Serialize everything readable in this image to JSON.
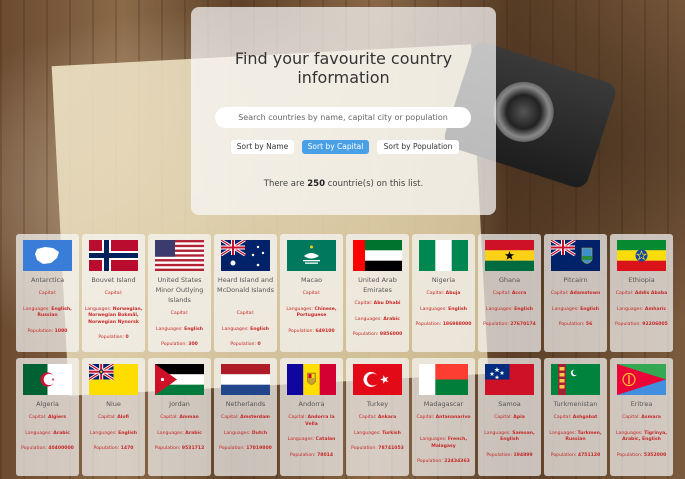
{
  "header": {
    "title": "Find your favourite country information",
    "search_placeholder": "Search countries by name, capital city or population",
    "sort_name": "Sort by Name",
    "sort_capital": "Sort by Capital",
    "sort_population": "Sort by Population",
    "count_prefix": "There are",
    "count_value": "250",
    "count_suffix": "countrie(s) on this list."
  },
  "labels": {
    "capital": "Capital:",
    "languages": "Languages:",
    "population": "Population:"
  },
  "countries": [
    {
      "name": "Antarctica",
      "capital": "",
      "languages": "English, Russian",
      "population": "1000",
      "flag": "antarctica-flag"
    },
    {
      "name": "Bouvet Island",
      "capital": "",
      "languages": "Norwegian, Norwegian Bokmål, Norwegian Nynorsk",
      "population": "0",
      "flag": "norway-flag"
    },
    {
      "name": "United States Minor Outlying Islands",
      "capital": "",
      "languages": "English",
      "population": "300",
      "flag": "usa-flag"
    },
    {
      "name": "Heard Island and McDonald Islands",
      "capital": "",
      "languages": "English",
      "population": "0",
      "flag": "australia-flag"
    },
    {
      "name": "Macao",
      "capital": "",
      "languages": "Chinese, Portuguese",
      "population": "649100",
      "flag": "macao-flag"
    },
    {
      "name": "United Arab Emirates",
      "capital": "Abu Dhabi",
      "languages": "Arabic",
      "population": "9856000",
      "flag": "uae-flag"
    },
    {
      "name": "Nigeria",
      "capital": "Abuja",
      "languages": "English",
      "population": "186988000",
      "flag": "nigeria-flag"
    },
    {
      "name": "Ghana",
      "capital": "Accra",
      "languages": "English",
      "population": "27670174",
      "flag": "ghana-flag"
    },
    {
      "name": "Pitcairn",
      "capital": "Adamstown",
      "languages": "English",
      "population": "56",
      "flag": "pitcairn-flag"
    },
    {
      "name": "Ethiopia",
      "capital": "Addis Ababa",
      "languages": "Amharic",
      "population": "92206005",
      "flag": "ethiopia-flag"
    },
    {
      "name": "Algeria",
      "capital": "Algiers",
      "languages": "Arabic",
      "population": "40400000",
      "flag": "algeria-flag"
    },
    {
      "name": "Niue",
      "capital": "Alofi",
      "languages": "English",
      "population": "1470",
      "flag": "niue-flag"
    },
    {
      "name": "Jordan",
      "capital": "Amman",
      "languages": "Arabic",
      "population": "9531712",
      "flag": "jordan-flag"
    },
    {
      "name": "Netherlands",
      "capital": "Amsterdam",
      "languages": "Dutch",
      "population": "17019800",
      "flag": "netherlands-flag"
    },
    {
      "name": "Andorra",
      "capital": "Andorra la Vella",
      "languages": "Catalan",
      "population": "78014",
      "flag": "andorra-flag"
    },
    {
      "name": "Turkey",
      "capital": "Ankara",
      "languages": "Turkish",
      "population": "78741053",
      "flag": "turkey-flag"
    },
    {
      "name": "Madagascar",
      "capital": "Antananarivo",
      "languages": "French, Malagasy",
      "population": "22434363",
      "flag": "madagascar-flag"
    },
    {
      "name": "Samoa",
      "capital": "Apia",
      "languages": "Samoan, English",
      "population": "194899",
      "flag": "samoa-flag"
    },
    {
      "name": "Turkmenistan",
      "capital": "Ashgabat",
      "languages": "Turkmen, Russian",
      "population": "4751120",
      "flag": "turkmenistan-flag"
    },
    {
      "name": "Eritrea",
      "capital": "Asmara",
      "languages": "Tigrinya, Arabic, English",
      "population": "5352000",
      "flag": "eritrea-flag"
    }
  ]
}
